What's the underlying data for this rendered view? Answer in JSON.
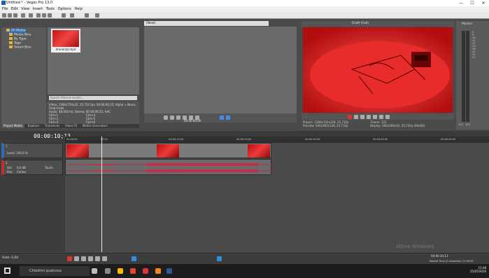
{
  "window": {
    "title": "Untitled * - Vegas Pro 13.0"
  },
  "menu": [
    "File",
    "Edit",
    "View",
    "Insert",
    "Tools",
    "Options",
    "Help"
  ],
  "media_tree": {
    "items": [
      "All Media",
      "Media Bins",
      "By Type",
      "Tags",
      "Smart Bins"
    ],
    "selected": "All Media"
  },
  "media_file": {
    "name": "droneript.mp4"
  },
  "media_search": {
    "placeholder": "Search filtered results..."
  },
  "media_info": {
    "line1": "Video: 1280x720x32, 25,732 fps; 00:00:00;25; Alpha = None; Field Order",
    "line2": "Audio: 48,000 Hz; Stereo; 00:00:00;25; AAC",
    "shortcuts": [
      [
        "Ctrl+1",
        "Ctrl+4"
      ],
      [
        "Ctrl+2",
        "Ctrl+5"
      ],
      [
        "Ctrl+3",
        "Ctrl+6"
      ]
    ]
  },
  "left_tabs": [
    "Project Media",
    "Explorer",
    "Transitions",
    "Video FX",
    "Media Generators"
  ],
  "trimmer": {
    "header": "[New]",
    "timecode": "00:00:00;00"
  },
  "preview": {
    "quality": "Draft (Full)",
    "project": "1280x720x128, 25,732p",
    "preview": "640x360x128, 25,732p",
    "frame": "331",
    "display": "300x169x32, 25,732p (60x60)",
    "labels": {
      "project": "Project:",
      "preview": "Preview:",
      "frame": "Frame:",
      "display": "Display:"
    }
  },
  "master": {
    "label": "Master",
    "scale": [
      "-3",
      "-6",
      "-9",
      "-12",
      "-15",
      "-18",
      "-21",
      "-24",
      "-27",
      "-30",
      "-33",
      "-36",
      "-39",
      "-42",
      "-45",
      "-48",
      "-51",
      "-54",
      "-57"
    ],
    "readout": [
      "0.0",
      "0.0"
    ]
  },
  "timeline": {
    "timecode": "00:00:10;13",
    "ruler": [
      "00:00:00",
      "00:00:05;00",
      "00:00:10;00",
      "00:00:15;00",
      "00:00:20;00",
      "00:00:25;00",
      "00:00:30;00",
      "00:00:35;00",
      "00:00:40;00",
      "00:00:45;00",
      "00:00:50;00",
      "00:00:55;00",
      "00:01:00;00"
    ],
    "marker": "+5:00",
    "video_track": {
      "number": "1",
      "level": "Level: 100,0 %"
    },
    "audio_track": {
      "number": "2",
      "vol": "Vol:",
      "vol_value": "0,0 dB",
      "pan": "Pan:",
      "pan_value": "Center",
      "touch": "Touch"
    }
  },
  "status": {
    "rate": "Rate: 0,00",
    "timecode": "00:00:10;13",
    "record": "Record Time (2 channels): 11:30:05"
  },
  "watermark": "Attiva Windows",
  "taskbar": {
    "search": "Chiedimi qualcosa",
    "time": "15:48",
    "date": "25/07/2016"
  }
}
